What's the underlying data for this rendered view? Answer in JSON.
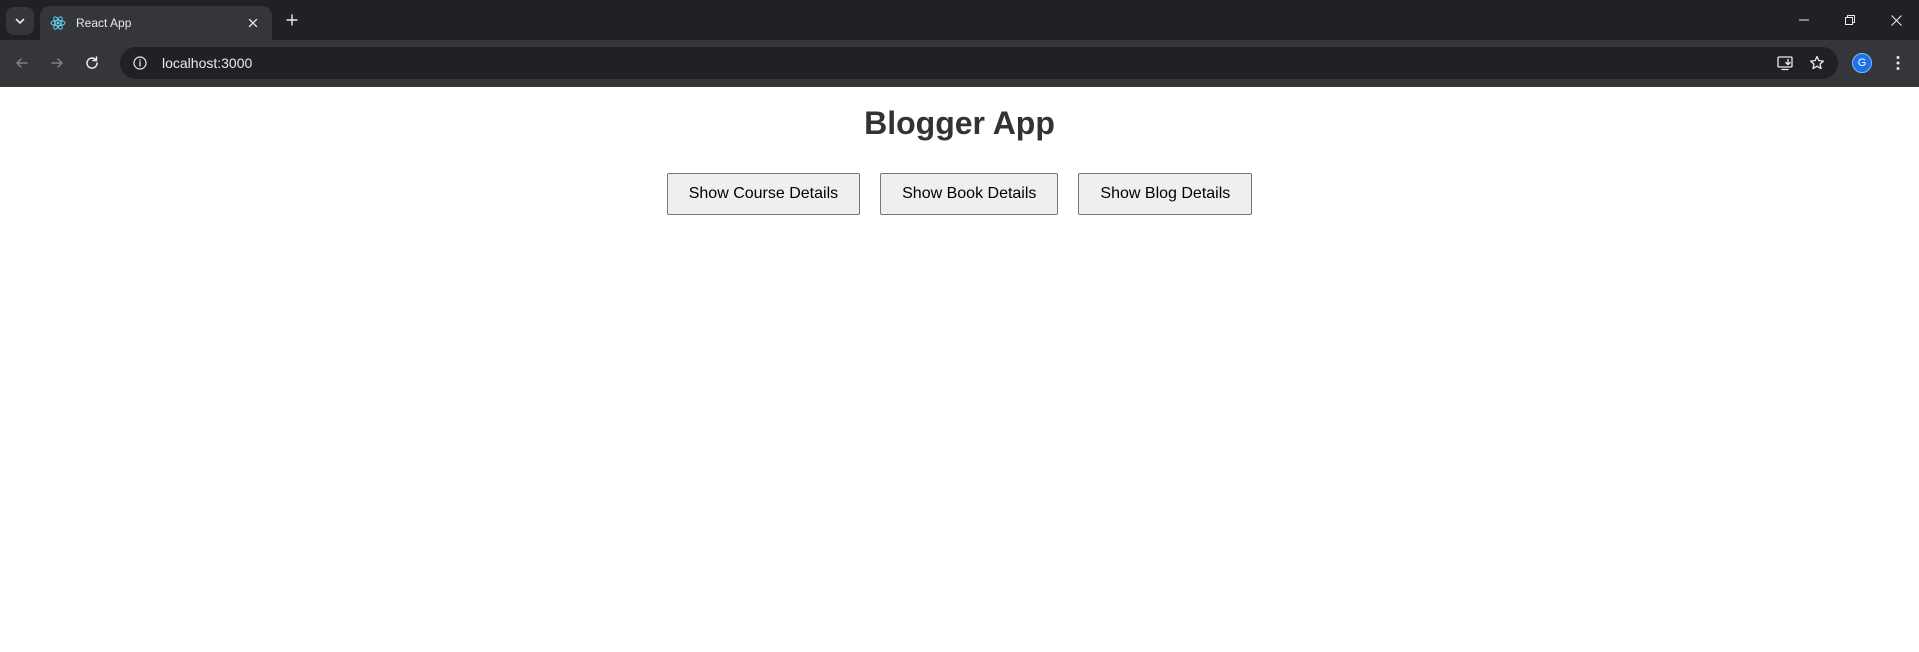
{
  "browser": {
    "tab_title": "React App",
    "url": "localhost:3000",
    "profile_initial": "G",
    "icons": {
      "tab_search": "chevron-down-icon",
      "favicon": "react-logo-icon",
      "tab_close": "close-icon",
      "new_tab": "plus-icon",
      "back": "arrow-left-icon",
      "forward": "arrow-right-icon",
      "reload": "reload-icon",
      "site_info": "info-icon",
      "install": "install-app-icon",
      "bookmark": "star-icon",
      "menu": "kebab-menu-icon"
    }
  },
  "page": {
    "title": "Blogger App",
    "buttons": [
      {
        "label": "Show Course Details"
      },
      {
        "label": "Show Book Details"
      },
      {
        "label": "Show Blog Details"
      }
    ]
  },
  "colors": {
    "chrome_dark": "#202124",
    "chrome_toolbar": "#35363a",
    "title_text": "#333333",
    "button_bg": "#efefef",
    "button_border": "#767676"
  }
}
